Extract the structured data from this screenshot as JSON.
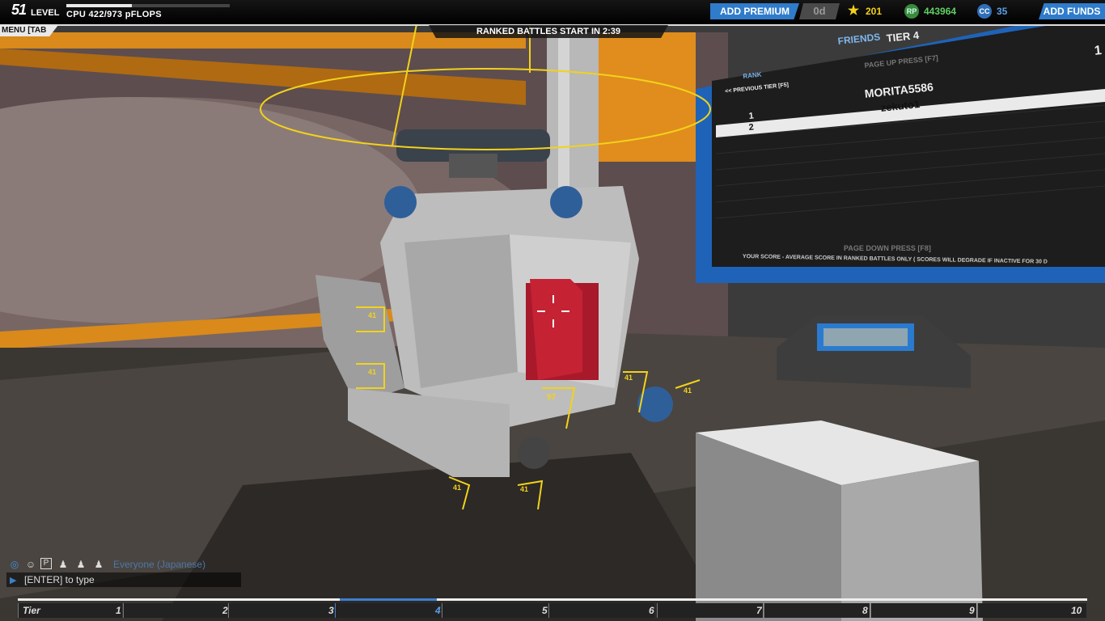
{
  "hud": {
    "level_number": "51",
    "level_label": "LEVEL",
    "level_progress": 0.4,
    "cpu_text": "CPU 422/973 pFLOPS",
    "premium_button": "ADD PREMIUM",
    "premium_days": "0d",
    "tech_points": "201",
    "robits": "443964",
    "robits_icon": "RP",
    "cosmetic_credits": "35",
    "cc_icon": "CC",
    "funds_button": "ADD FUNDS",
    "menu_tab": "MENU [TAB",
    "battle_timer": "RANKED BATTLES START IN 2:39"
  },
  "leaderboard": {
    "header": "FRIENDS",
    "tier": "TIER 4",
    "page_up": "PAGE UP PRESS  [F7]",
    "rank_label": "RANK",
    "previous_tier": "<< PREVIOUS TIER [F5]",
    "entries": [
      {
        "rank": "1",
        "name": "MORITA5586"
      },
      {
        "rank": "2",
        "name": "zekuto1"
      }
    ],
    "page_down": "PAGE DOWN PRESS  [F8]",
    "footer": "YOUR SCORE - AVERAGE SCORE IN RANKED BATTLES ONLY ( SCORES WILL DEGRADE IF INACTIVE FOR 30 D",
    "corner_number": "1"
  },
  "robot_labels": [
    "97",
    "41",
    "41",
    "41",
    "41",
    "41",
    "41"
  ],
  "chat": {
    "channel": "Everyone (Japanese)",
    "placeholder": "[ENTER] to type",
    "icons": [
      "globe-icon",
      "person-icon",
      "p-icon",
      "user-1-icon",
      "user-2-icon",
      "user-8-icon"
    ]
  },
  "tiers": {
    "label": "Tier",
    "numbers": [
      "1",
      "2",
      "3",
      "4",
      "5",
      "6",
      "7",
      "8",
      "9",
      "10"
    ],
    "current": "4"
  },
  "colors": {
    "accent_blue": "#2f7ccb",
    "hud_yellow": "#f2d21b",
    "arena_orange": "#d98a1a",
    "robits_green": "#5fcf62"
  }
}
